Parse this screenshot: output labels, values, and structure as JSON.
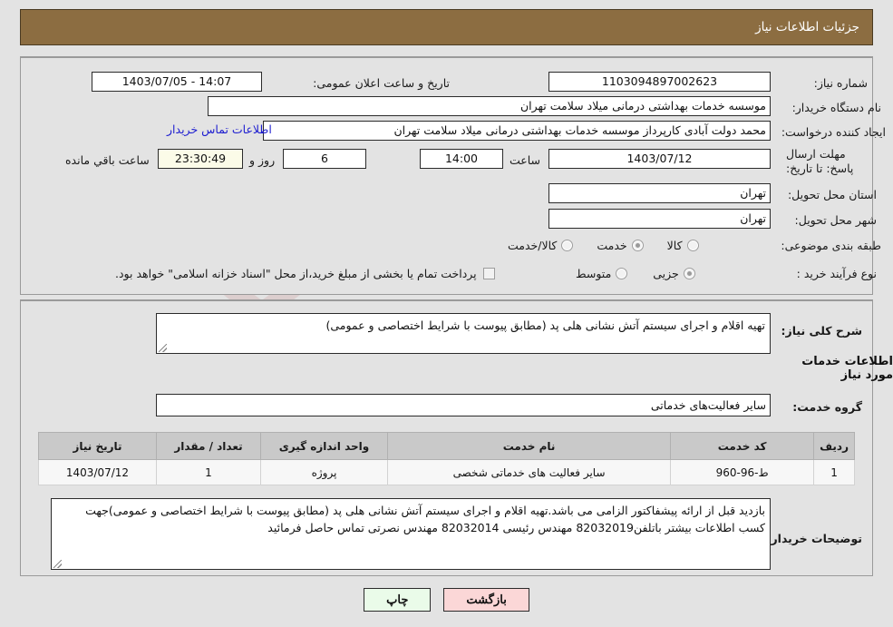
{
  "header": {
    "title": "جزئیات اطلاعات نیاز"
  },
  "fields": {
    "need_number_label": "شماره نیاز:",
    "need_number_value": "1103094897002623",
    "announce_label": "تاریخ و ساعت اعلان عمومی:",
    "announce_value": "14:07 - 1403/07/05",
    "buyer_org_label": "نام دستگاه خریدار:",
    "buyer_org_value": "موسسه خدمات بهداشتی درمانی میلاد سلامت تهران",
    "creator_label": "ایجاد کننده درخواست:",
    "creator_value": "محمد دولت آبادی کارپرداز موسسه خدمات بهداشتی درمانی میلاد سلامت تهران",
    "contact_link": "اطلاعات تماس خریدار",
    "deadline_label": "مهلت ارسال پاسخ: تا تاریخ:",
    "deadline_date": "1403/07/12",
    "deadline_time_label": "ساعت",
    "deadline_time": "14:00",
    "days_value": "6",
    "days_unit_label": "روز و",
    "countdown_value": "23:30:49",
    "countdown_label": "ساعت باقي مانده",
    "province_label": "استان محل تحویل:",
    "province_value": "تهران",
    "city_label": "شهر محل تحویل:",
    "city_value": "تهران",
    "category_label": "طبقه بندی موضوعی:",
    "process_label": "نوع فرآیند خرید :",
    "treasury_note": "پرداخت تمام یا بخشی از مبلغ خرید،از محل \"اسناد خزانه اسلامی\" خواهد بود."
  },
  "category_options": [
    {
      "label": "کالا",
      "selected": false
    },
    {
      "label": "خدمت",
      "selected": true
    },
    {
      "label": "کالا/خدمت",
      "selected": false
    }
  ],
  "process_options": [
    {
      "label": "جزیی",
      "selected": true
    },
    {
      "label": "متوسط",
      "selected": false
    }
  ],
  "treasury_checkbox": {
    "checked": false
  },
  "description": {
    "label": "شرح کلی نیاز:",
    "value": "تهیه اقلام و اجرای سیستم آتش نشانی هلی پد (مطابق پیوست با شرایط اختصاصی و عمومی)"
  },
  "services_section": {
    "heading": "اطلاعات خدمات مورد نیاز",
    "group_label": "گروه خدمت:",
    "group_value": "سایر فعالیت‌های خدماتی"
  },
  "table": {
    "columns": [
      "ردیف",
      "کد خدمت",
      "نام خدمت",
      "واحد اندازه گیری",
      "تعداد / مقدار",
      "تاریخ نیاز"
    ],
    "rows": [
      {
        "index": "1",
        "code": "ط-96-960",
        "name": "سایر فعالیت های خدماتی شخصی",
        "unit": "پروژه",
        "qty": "1",
        "need_date": "1403/07/12"
      }
    ]
  },
  "buyer_notes": {
    "label": "توضیحات خریدار:",
    "value": "بازدید قبل از ارائه پیشفاکتور الزامی می باشد.تهیه اقلام و اجرای سیستم آتش نشانی هلی پد (مطابق پیوست با شرایط اختصاصی و عمومی)جهت کسب اطلاعات بیشتر باتلفن82032019 مهندس رئیسی 82032014 مهندس نصرتی تماس حاصل فرمائید"
  },
  "buttons": {
    "print": "چاپ",
    "back": "بازگشت"
  },
  "watermark": {
    "text": "AriaTender.net"
  },
  "colors": {
    "header_bg": "#8c6d41",
    "page_bg": "#e3e3e3",
    "link": "#1c1cd0",
    "back_btn": "#fbd7d7",
    "print_btn": "#eafbe9",
    "countdown_bg": "#fbfbe8"
  }
}
